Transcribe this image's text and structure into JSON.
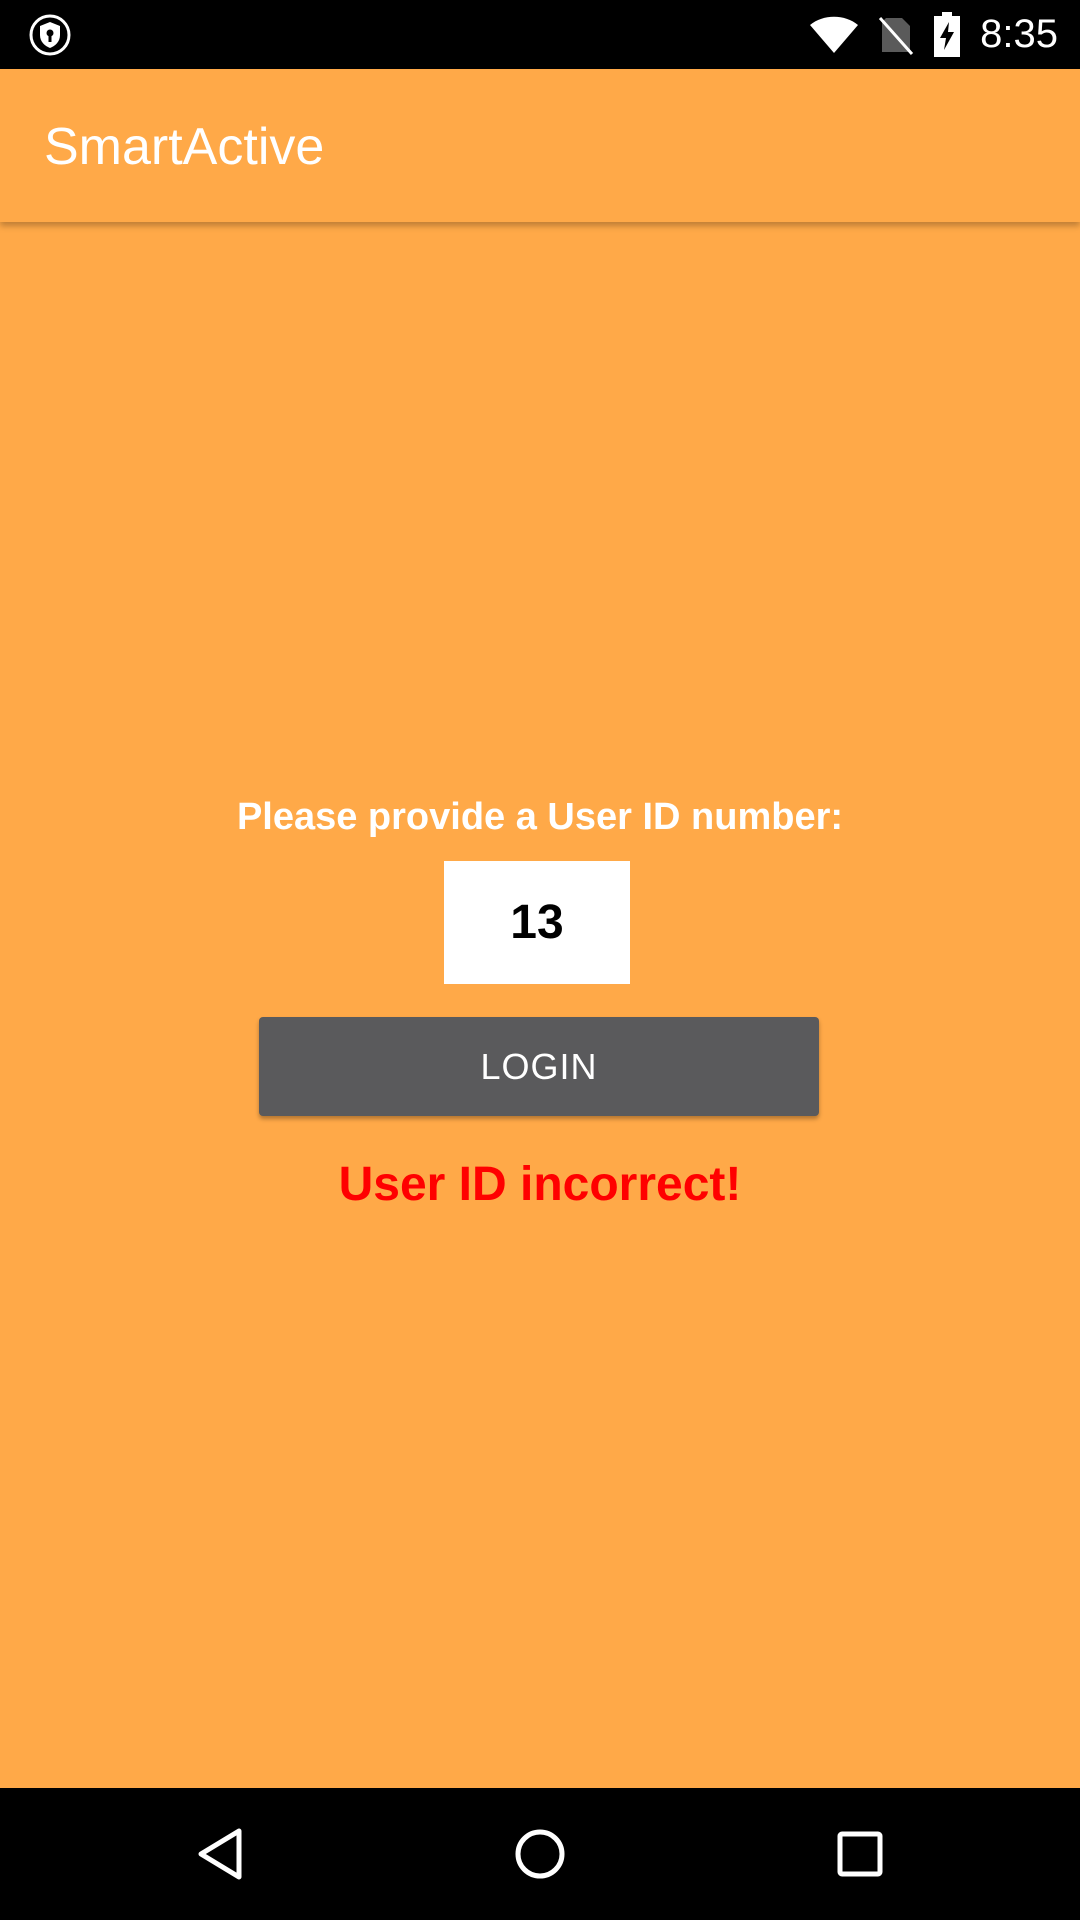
{
  "status_bar": {
    "time": "8:35",
    "icons": [
      "vpn-shield-icon",
      "wifi-icon",
      "no-sim-icon",
      "battery-charging-icon"
    ]
  },
  "app_bar": {
    "title": "SmartActive"
  },
  "login": {
    "prompt": "Please provide a User ID number:",
    "user_id_value": "13",
    "button_label": "LOGIN",
    "error_message": "User ID incorrect!"
  },
  "nav_bar": {
    "icons": [
      "back-icon",
      "home-icon",
      "recents-icon"
    ]
  },
  "colors": {
    "background": "#FFA948",
    "button": "#5A5A5C",
    "error": "#FF0000",
    "status_bar": "#000000"
  }
}
